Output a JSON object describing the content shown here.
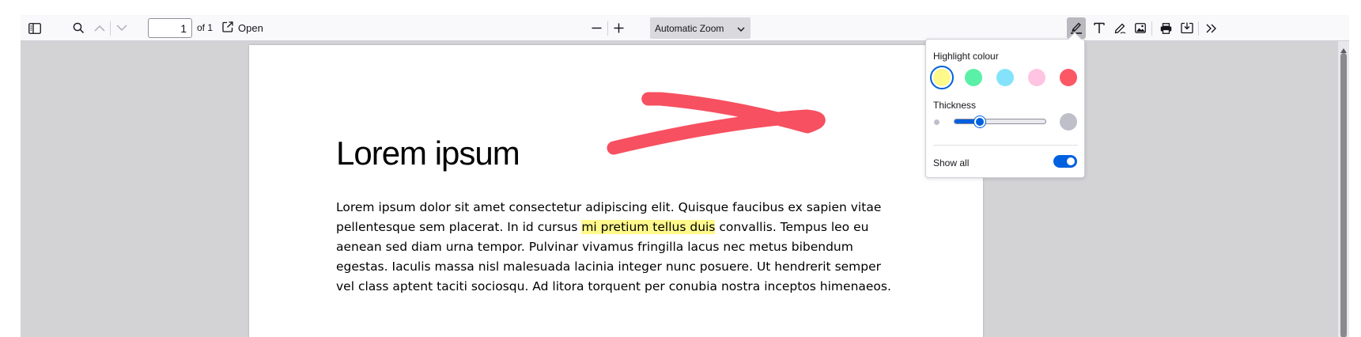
{
  "toolbar": {
    "page_number": "1",
    "page_count_label": "of 1",
    "open_label": "Open",
    "zoom_value": "Automatic Zoom"
  },
  "document": {
    "title": "Lorem ipsum",
    "body_lines": [
      {
        "before": "Lorem ipsum dolor sit amet consectetur adipiscing elit. Quisque faucibus ex sapien vitae",
        "highlight": "",
        "after": ""
      },
      {
        "before": "pellentesque sem placerat. In id cursus ",
        "highlight": "mi pretium tellus duis",
        "after": " convallis. Tempus leo eu"
      },
      {
        "before": "aenean sed diam urna tempor. Pulvinar vivamus fringilla lacus nec metus bibendum",
        "highlight": "",
        "after": ""
      },
      {
        "before": "egestas. Iaculis massa nisl malesuada lacinia integer nunc posuere. Ut hendrerit semper",
        "highlight": "",
        "after": ""
      },
      {
        "before": "vel class aptent taciti sociosqu. Ad litora torquent per conubia nostra inceptos himenaeos.",
        "highlight": "",
        "after": ""
      }
    ],
    "ink_color": "#f75060",
    "highlight_color": "#fff98c"
  },
  "highlight_popup": {
    "colour_label": "Highlight colour",
    "colours": [
      {
        "name": "yellow",
        "hex": "#fff98c",
        "selected": true
      },
      {
        "name": "green",
        "hex": "#5bf0a7",
        "selected": false
      },
      {
        "name": "blue",
        "hex": "#84e3fb",
        "selected": false
      },
      {
        "name": "pink",
        "hex": "#ffc4e1",
        "selected": false
      },
      {
        "name": "red",
        "hex": "#fb5765",
        "selected": false
      }
    ],
    "thickness_label": "Thickness",
    "thickness_fraction": 0.28,
    "show_all_label": "Show all",
    "show_all": true
  },
  "colors": {
    "accent": "#0060df",
    "viewer_background": "#d3d3d6",
    "toolbar_background": "#f9f9fb"
  }
}
